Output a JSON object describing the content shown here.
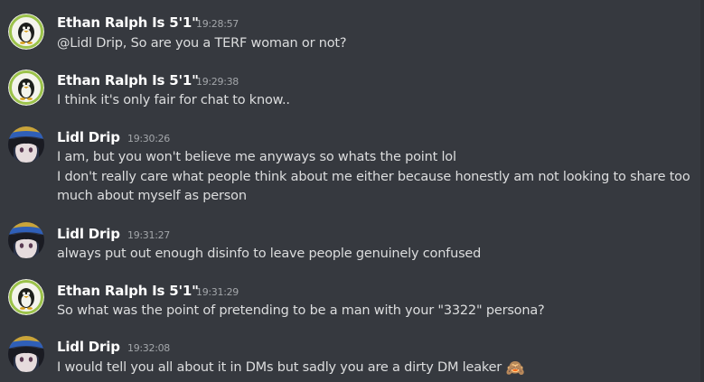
{
  "messages": [
    {
      "author": "Ethan Ralph Is 5'1\"",
      "timestamp": "19:28:57",
      "avatar": "penguin-avatar",
      "lines": [
        "@Lidl Drip, So are you a TERF woman or not?"
      ]
    },
    {
      "author": "Ethan Ralph Is 5'1\"",
      "timestamp": "19:29:38",
      "avatar": "penguin-avatar",
      "lines": [
        "I think it's only fair for chat to know.."
      ]
    },
    {
      "author": "Lidl Drip",
      "timestamp": "19:30:26",
      "avatar": "anime-avatar",
      "lines": [
        "I am, but you won't believe me anyways so whats the point lol",
        "I don't really care what people think about me either because honestly am not looking to share too",
        "much about myself as person"
      ]
    },
    {
      "author": "Lidl Drip",
      "timestamp": "19:31:27",
      "avatar": "anime-avatar",
      "lines": [
        "always put out enough disinfo to leave people genuinely confused"
      ]
    },
    {
      "author": "Ethan Ralph Is 5'1\"",
      "timestamp": "19:31:29",
      "avatar": "penguin-avatar",
      "lines": [
        "So what was the point of pretending to be a man with your \"3322\" persona?"
      ]
    },
    {
      "author": "Lidl Drip",
      "timestamp": "19:32:08",
      "avatar": "anime-avatar",
      "lines": [
        "I would tell you all about it in DMs but sadly you are a dirty DM leaker"
      ],
      "emoji": "🙈",
      "emoji_name": "see-no-evil-monkey-emoji"
    }
  ],
  "colors": {
    "background": "#36393f",
    "username": "#ffffff",
    "text": "#dcddde",
    "timestamp": "#a3a6aa"
  }
}
